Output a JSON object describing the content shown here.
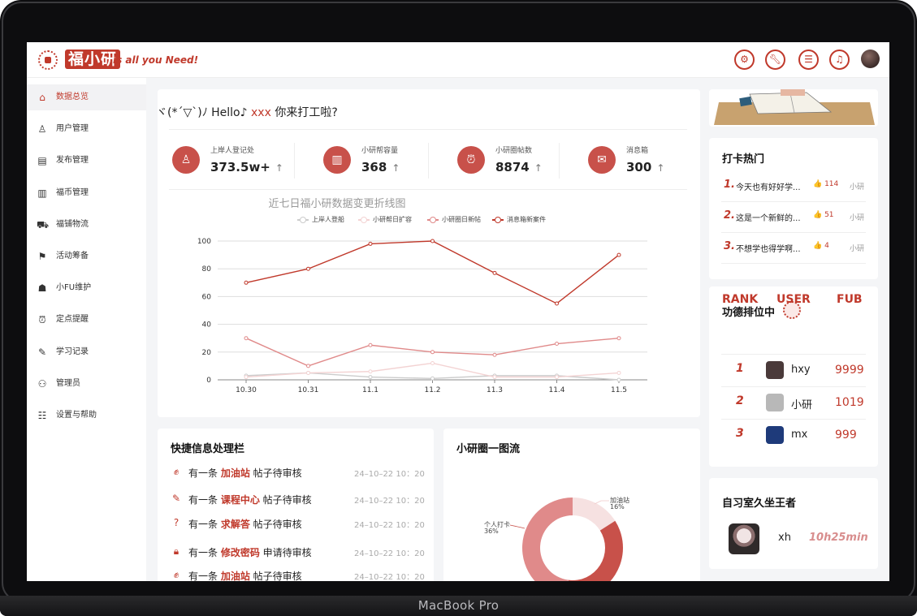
{
  "device": {
    "label": "MacBook Pro"
  },
  "header": {
    "logo_text": "福小研",
    "slogan": "is all you Need!",
    "icons": [
      "gear-icon",
      "wrench-icon",
      "search-list-icon",
      "bell-icon"
    ]
  },
  "sidebar": {
    "items": [
      {
        "label": "数据总览",
        "icon": "home-icon",
        "active": true
      },
      {
        "label": "用户管理",
        "icon": "user-icon"
      },
      {
        "label": "发布管理",
        "icon": "document-icon"
      },
      {
        "label": "福币管理",
        "icon": "coins-icon"
      },
      {
        "label": "福铺物流",
        "icon": "truck-icon"
      },
      {
        "label": "活动筹备",
        "icon": "flag-icon"
      },
      {
        "label": "小FU维护",
        "icon": "robot-icon"
      },
      {
        "label": "定点提醒",
        "icon": "alarm-icon"
      },
      {
        "label": "学习记录",
        "icon": "pencil-icon"
      },
      {
        "label": "管理员",
        "icon": "admin-icon"
      },
      {
        "label": "设置与帮助",
        "icon": "settings-list-icon"
      }
    ]
  },
  "welcome": {
    "prefix": "ヾ(*´▽`)ﾉ Hello♪ ",
    "name": "xxx",
    "suffix": " 你来打工啦?"
  },
  "stats": [
    {
      "label": "上岸人登记处",
      "value": "373.5w+",
      "arrow": "↑",
      "icon": "user-icon"
    },
    {
      "label": "小研帮容量",
      "value": "368",
      "arrow": "↑",
      "icon": "book-icon"
    },
    {
      "label": "小研圈帖数",
      "value": "8874",
      "arrow": "↑",
      "icon": "alarm-clock-icon"
    },
    {
      "label": "消息箱",
      "value": "300",
      "arrow": "↑",
      "icon": "chat-icon"
    }
  ],
  "chart_data": {
    "type": "line",
    "title": "近七日福小研数据变更折线图",
    "x": [
      "10.30",
      "10.31",
      "11.1",
      "11.2",
      "11.3",
      "11.4",
      "11.5"
    ],
    "ylim": [
      0,
      100
    ],
    "yticks": [
      0,
      20,
      40,
      60,
      80,
      100
    ],
    "grid": true,
    "legend_position": "top",
    "series": [
      {
        "name": "上岸人登船",
        "color": "#cccccc",
        "values": [
          3,
          5,
          2,
          1,
          3,
          3,
          0
        ]
      },
      {
        "name": "小研帮日扩容",
        "color": "#f3d3d3",
        "values": [
          2,
          5,
          6,
          12,
          2,
          2,
          5
        ]
      },
      {
        "name": "小研圈日新帖",
        "color": "#e08a8a",
        "values": [
          30,
          10,
          25,
          20,
          18,
          26,
          30
        ]
      },
      {
        "name": "消息箱新案件",
        "color": "#c0392b",
        "values": [
          70,
          80,
          98,
          100,
          77,
          55,
          90
        ]
      }
    ]
  },
  "quick_panel": {
    "title": "快捷信息处理栏",
    "rows": [
      {
        "icon": "fist-icon",
        "prefix": "有一条 ",
        "link": "加油站",
        "suffix": " 帖子待审核",
        "time": "24–10–22 10：20"
      },
      {
        "icon": "edit-doc-icon",
        "prefix": "有一条 ",
        "link": "课程中心",
        "suffix": " 帖子待审核",
        "time": "24–10–22 10：20"
      },
      {
        "icon": "question-icon",
        "prefix": "有一条 ",
        "link": "求解答",
        "suffix": " 帖子待审核",
        "time": "24–10–22 10：20"
      },
      {
        "icon": "lock-icon",
        "prefix": "有一条 ",
        "link": "修改密码",
        "suffix": " 申请待审核",
        "time": "24–10–22 10：20"
      },
      {
        "icon": "fist-icon",
        "prefix": "有一条 ",
        "link": "加油站",
        "suffix": " 帖子待审核",
        "time": "24–10–22 10：20"
      }
    ]
  },
  "donut": {
    "title": "小研圈一图流",
    "slices": [
      {
        "name": "加油站",
        "value": 16,
        "label": "16%",
        "color": "#f6e1e1"
      },
      {
        "name": "个人打卡",
        "value": 36,
        "label": "36%",
        "color": "#c8514a"
      },
      {
        "name": "other",
        "value": 48,
        "color": "#e08a8a"
      }
    ]
  },
  "hot": {
    "title": "打卡热门",
    "items": [
      {
        "rank": "1.",
        "text": "今天也有好好学...",
        "likes": "👍 114",
        "author": "小研"
      },
      {
        "rank": "2.",
        "text": "这是一个新鲜的...",
        "likes": "👍 51",
        "author": "小研"
      },
      {
        "rank": "3.",
        "text": "不想学也得学啊...",
        "likes": "👍 4",
        "author": "小研"
      }
    ]
  },
  "merit": {
    "title": "功德排位中",
    "headers": {
      "rank": "RANK",
      "user": "USER",
      "fub": "FUB"
    },
    "rows": [
      {
        "rank": "1",
        "user": "hxy",
        "fub": "9999",
        "avatar_color": "#4a3a3a"
      },
      {
        "rank": "2",
        "user": "小研",
        "fub": "1019",
        "avatar_color": "#b8b8b8"
      },
      {
        "rank": "3",
        "user": "mx",
        "fub": "999",
        "avatar_color": "#1e3a7a"
      }
    ]
  },
  "study": {
    "title": "自习室久坐王者",
    "user": "xh",
    "time": "10h25min"
  }
}
